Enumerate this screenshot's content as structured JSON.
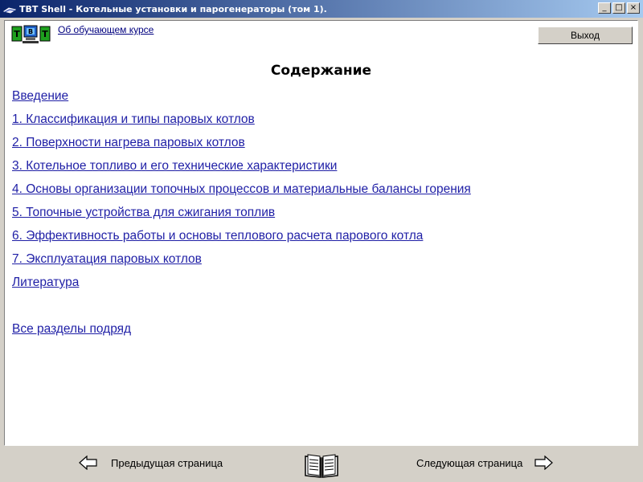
{
  "window": {
    "title": "TBT Shell - Котельные установки и парогенераторы (том 1).",
    "minimize": "_",
    "maximize": "□",
    "close": "×"
  },
  "header": {
    "about_link": "Об обучающем курсе",
    "exit_button": "Выход"
  },
  "main": {
    "title": "Содержание",
    "toc": [
      "Введение",
      "1. Классификация и типы паровых котлов",
      "2. Поверхности нагрева паровых котлов",
      "3. Котельное топливо и его технические характеристики",
      "4. Основы организации топочных процессов и материальные балансы горения",
      "5. Топочные устройства для сжигания топлив",
      "6. Эффективность работы и основы теплового расчета парового котла",
      "7. Эксплуатация паровых котлов",
      "Литература"
    ],
    "all_sections": "Все разделы подряд"
  },
  "navigation": {
    "prev": "Предыдущая страница",
    "next": "Следующая страница"
  },
  "icons": {
    "app": "app-icon",
    "logo": "tbt-logo-icon",
    "prev": "arrow-left-icon",
    "contents": "book-icon",
    "next": "arrow-right-icon"
  }
}
